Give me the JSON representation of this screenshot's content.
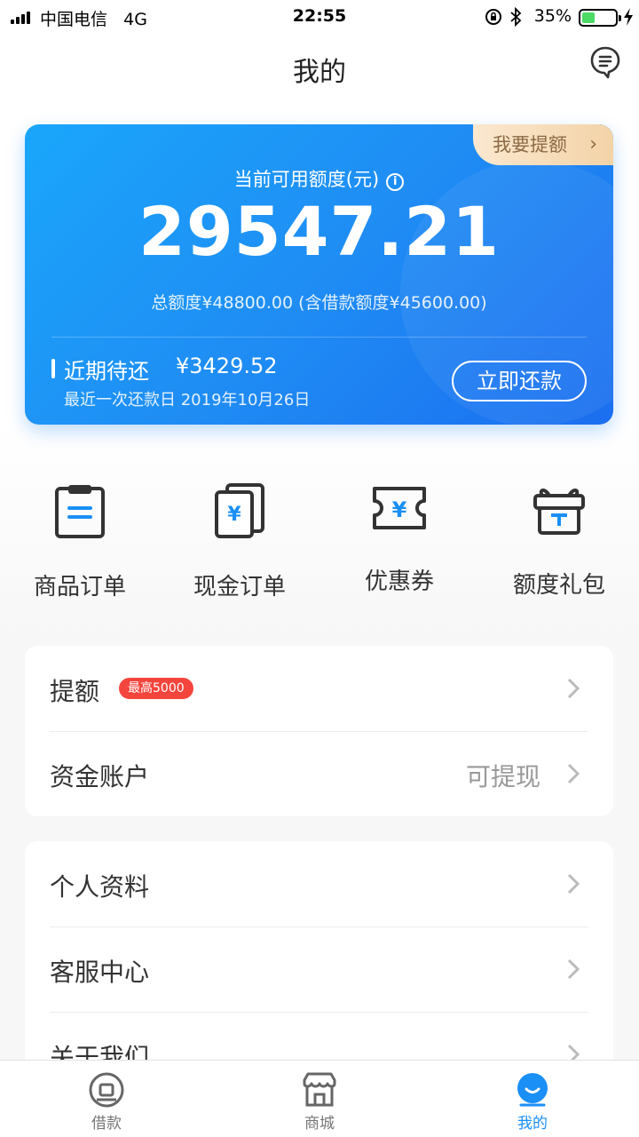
{
  "status_bar": {
    "carrier": "中国电信",
    "network": "4G",
    "time": "22:55",
    "battery": "35%"
  },
  "header": {
    "title": "我的",
    "icons": [
      "message-icon"
    ]
  },
  "credit_card": {
    "raise_tag": "我要提额",
    "available_label": "当前可用额度(元)",
    "available_amount": "29547.21",
    "total_quota": "总额度¥48800.00 (含借款额度¥45600.00)",
    "due_label": "近期待还",
    "due_amount": "¥3429.52",
    "due_date": "最近一次还款日 2019年10月26日",
    "repay_button": "立即还款",
    "colors": {
      "start": "#1aa6fb",
      "end": "#1b6ef0",
      "tag": "#f3d3a8"
    }
  },
  "quick_entries": [
    {
      "label": "商品订单",
      "icon": "clipboard-icon"
    },
    {
      "label": "现金订单",
      "icon": "cash-order-icon"
    },
    {
      "label": "优惠券",
      "icon": "coupon-icon"
    },
    {
      "label": "额度礼包",
      "icon": "gift-icon"
    }
  ],
  "menu_group_1": [
    {
      "label": "提额",
      "badge": "最高5000"
    },
    {
      "label": "资金账户",
      "value": "可提现"
    }
  ],
  "menu_group_2": [
    {
      "label": "个人资料"
    },
    {
      "label": "客服中心"
    },
    {
      "label": "关于我们"
    }
  ],
  "tab_bar": {
    "tabs": [
      {
        "label": "借款",
        "icon": "loan-icon"
      },
      {
        "label": "商城",
        "icon": "store-icon"
      },
      {
        "label": "我的",
        "icon": "profile-icon",
        "active": true
      }
    ],
    "active_color": "#1a8ff5"
  }
}
